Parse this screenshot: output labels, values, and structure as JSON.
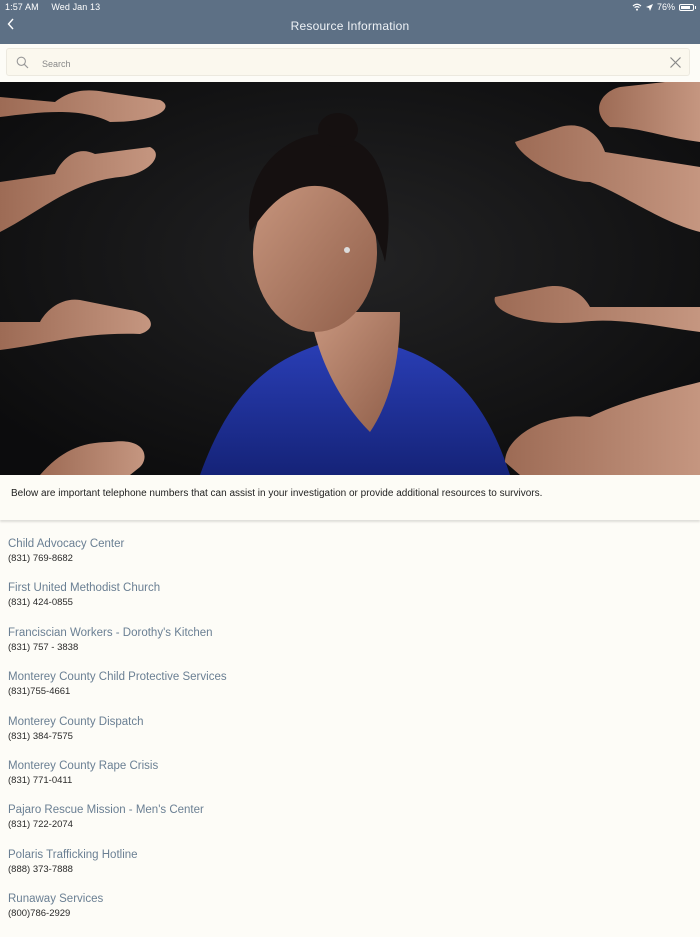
{
  "status_bar": {
    "time": "1:57 AM",
    "date": "Wed Jan 13",
    "battery": "76%"
  },
  "header": {
    "title": "Resource Information"
  },
  "search": {
    "placeholder": "Search"
  },
  "intro": {
    "text": "Below are important telephone numbers that can assist in your investigation or provide additional resources to survivors."
  },
  "resources": [
    {
      "name": "Child Advocacy Center",
      "phone": "(831) 769-8682"
    },
    {
      "name": "First United Methodist Church",
      "phone": "(831) 424-0855"
    },
    {
      "name": "Franciscian Workers - Dorothy's Kitchen",
      "phone": "(831) 757 - 3838"
    },
    {
      "name": "Monterey County Child Protective Services",
      "phone": "(831)755-4661"
    },
    {
      "name": "Monterey County Dispatch",
      "phone": "(831) 384-7575"
    },
    {
      "name": "Monterey County Rape Crisis",
      "phone": "(831) 771-0411"
    },
    {
      "name": "Pajaro Rescue Mission - Men's Center",
      "phone": "(831) 722-2074"
    },
    {
      "name": "Polaris Trafficking Hotline",
      "phone": "(888) 373-7888"
    },
    {
      "name": "Runaway Services",
      "phone": "(800)786-2929"
    }
  ],
  "colors": {
    "header_bg": "#5d7085",
    "link": "#6a7f93",
    "page_bg": "#fdfcf7"
  },
  "icons": [
    "back-chevron-icon",
    "wifi-icon",
    "location-arrow-icon",
    "battery-icon",
    "search-icon",
    "close-icon"
  ]
}
